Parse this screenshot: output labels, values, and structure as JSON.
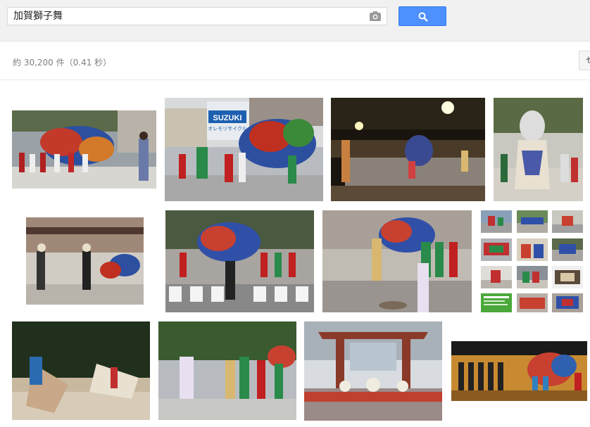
{
  "search": {
    "query": "加賀獅子舞"
  },
  "results": {
    "stats": "約 30,200 件（0.41 秒）"
  },
  "tools": {
    "label": "セ"
  },
  "images": {
    "sign_text": "SUZUKI",
    "sign_sub": "オレモリサイクル"
  },
  "colors": {
    "accent": "#4d90fe",
    "topbar": "#f1f1f1"
  }
}
